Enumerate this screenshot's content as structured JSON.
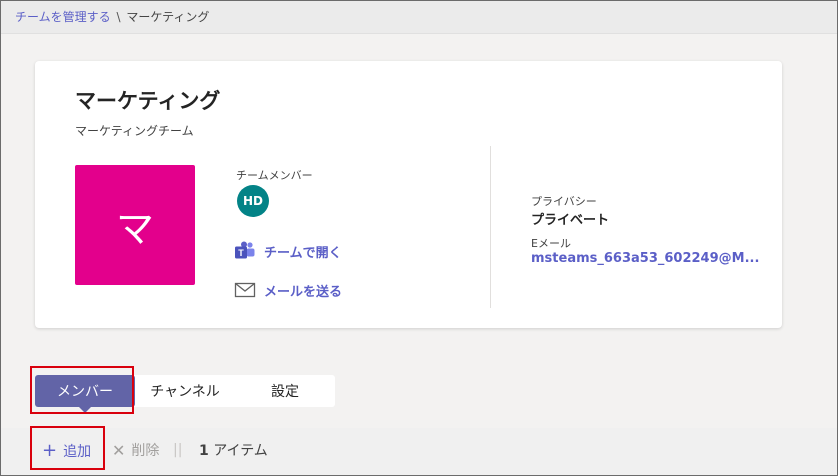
{
  "breadcrumb": {
    "parent": "チームを管理する",
    "separator": "\\",
    "current": "マーケティング"
  },
  "team": {
    "name": "マーケティング",
    "description": "マーケティングチーム",
    "avatar_letter": "マ",
    "avatar_color": "#e3008c"
  },
  "members": {
    "label": "チームメンバー",
    "avatars": [
      {
        "initials": "HD",
        "color": "#038387"
      }
    ]
  },
  "actions": {
    "open_in_teams": "チームで開く",
    "send_mail": "メールを送る"
  },
  "privacy": {
    "label": "プライバシー",
    "value": "プライベート"
  },
  "email": {
    "label": "Eメール",
    "value": "msteams_663a53_602249@M..."
  },
  "tabs": [
    {
      "label": "メンバー",
      "active": true
    },
    {
      "label": "チャンネル",
      "active": false
    },
    {
      "label": "設定",
      "active": false
    }
  ],
  "toolbar": {
    "add_label": "追加",
    "delete_label": "削除",
    "separator": "||",
    "count_number": "1",
    "count_unit": "アイテム"
  },
  "colors": {
    "accent": "#5b5fc7",
    "tab_active": "#6264a7",
    "highlight": "#d9000d"
  }
}
